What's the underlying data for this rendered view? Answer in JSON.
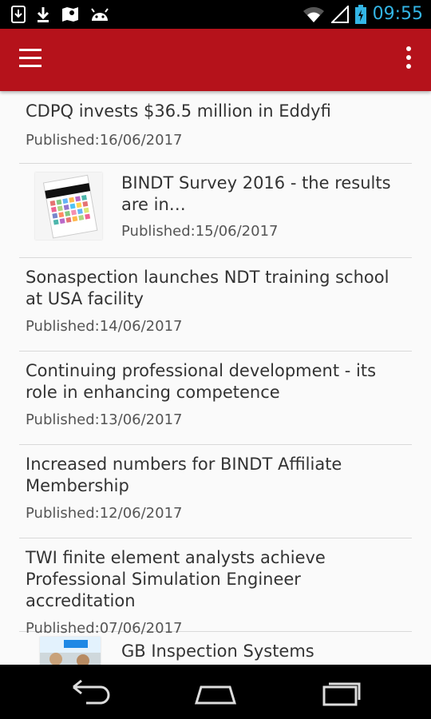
{
  "status_bar": {
    "time": "09:55",
    "left_icons": [
      "sim-card-icon",
      "download-icon",
      "map-location-icon",
      "android-icon"
    ],
    "right_icons": [
      "wifi-icon",
      "cell-signal-icon",
      "battery-charging-icon"
    ],
    "accent_color": "#33b5e5"
  },
  "app_bar": {
    "color": "#b5121b",
    "menu_icon": "hamburger-menu-icon",
    "overflow_icon": "overflow-menu-icon"
  },
  "articles": [
    {
      "title": "CDPQ invests $36.5 million in Eddyfi",
      "date": "Published:16/06/2017"
    },
    {
      "title": "BINDT Survey 2016 - the results are in…",
      "date": "Published:15/06/2017",
      "thumbnail": "survey-report-thumbnail"
    },
    {
      "title": "Sonaspection launches NDT training school at USA facility",
      "date": "Published:14/06/2017"
    },
    {
      "title": "Continuing professional development - its role in enhancing competence",
      "date": "Published:13/06/2017"
    },
    {
      "title": "Increased numbers for BINDT Affiliate Membership",
      "date": "Published:12/06/2017"
    },
    {
      "title": "TWI finite element analysts achieve Professional Simulation Engineer accreditation",
      "date": "Published:07/06/2017"
    },
    {
      "title": "GB Inspection Systems announces",
      "date": "",
      "thumbnail": "people-photo-thumbnail"
    }
  ],
  "nav_bar": {
    "buttons": [
      "back-icon",
      "home-icon",
      "recent-apps-icon"
    ]
  }
}
